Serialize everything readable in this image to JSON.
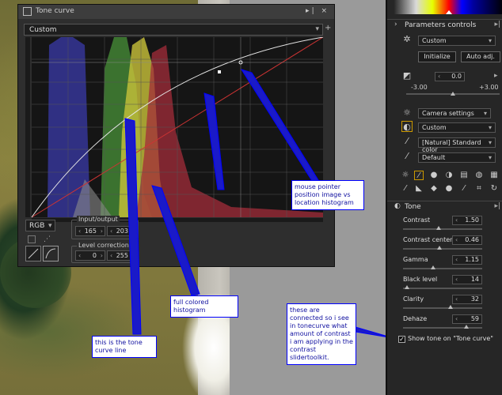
{
  "tone_curve": {
    "title": "Tone curve",
    "preset": "Custom",
    "channel": "RGB",
    "input_output_label": "Input/output",
    "input_value": "165",
    "output_value": "203",
    "level_correction_label": "Level correction",
    "level_low": "0",
    "level_high": "255"
  },
  "annotations": {
    "mouse_pointer": "mouse pointer position image vs location histogram",
    "full_histogram": "full colored histogram",
    "tone_curve_line": "this is the tone curve line",
    "connected": "these are connected so i see in tonecurve what amount of contrast i am applying in the contrast slidertoolkit."
  },
  "panel": {
    "parameters_title": "Parameters controls",
    "params_preset": "Custom",
    "initialize": "Initialize",
    "auto_adj": "Auto adj.",
    "exposure_value": "0.0",
    "exposure_min": "-3.00",
    "exposure_max": "+3.00",
    "camera_settings": "Camera settings",
    "custom2": "Custom",
    "picture_style": "[Natural] Standard color",
    "default": "Default",
    "tone_title": "Tone",
    "rows": [
      {
        "label": "Contrast",
        "value": "1.50",
        "pos": 0.45
      },
      {
        "label": "Contrast center",
        "value": "0.46",
        "pos": 0.46
      },
      {
        "label": "Gamma",
        "value": "1.15",
        "pos": 0.38
      },
      {
        "label": "Black level",
        "value": "14",
        "pos": 0.05
      },
      {
        "label": "Clarity",
        "value": "32",
        "pos": 0.6
      },
      {
        "label": "Dehaze",
        "value": "59",
        "pos": 0.8
      }
    ],
    "show_tone": "Show tone on \"Tone curve\""
  }
}
